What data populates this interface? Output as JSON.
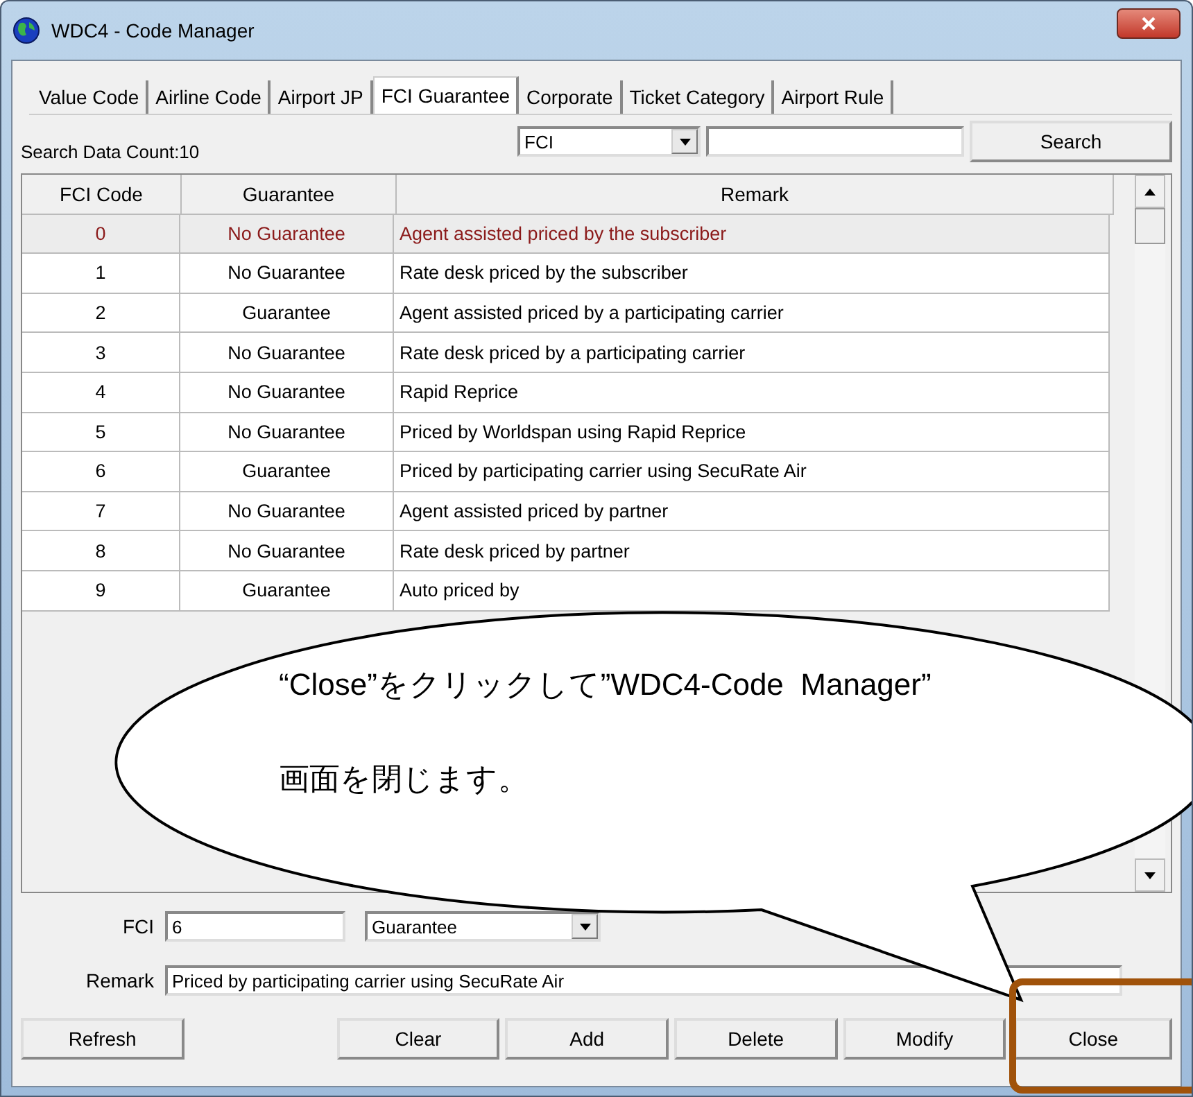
{
  "window": {
    "title": "WDC4 - Code Manager"
  },
  "tabs": [
    {
      "label": "Value Code",
      "selected": false
    },
    {
      "label": "Airline Code",
      "selected": false
    },
    {
      "label": "Airport JP",
      "selected": false
    },
    {
      "label": "FCI Guarantee",
      "selected": true
    },
    {
      "label": "Corporate",
      "selected": false
    },
    {
      "label": "Ticket Category",
      "selected": false
    },
    {
      "label": "Airport Rule",
      "selected": false
    }
  ],
  "search": {
    "count_label": "Search Data Count:10",
    "field_select": "FCI",
    "button": "Search"
  },
  "table": {
    "columns": [
      "FCI Code",
      "Guarantee",
      "Remark"
    ],
    "rows": [
      {
        "cells": [
          "0",
          "No Guarantee",
          "Agent assisted priced by the subscriber"
        ],
        "selected": true
      },
      {
        "cells": [
          "1",
          "No Guarantee",
          "Rate desk priced by the subscriber"
        ],
        "selected": false
      },
      {
        "cells": [
          "2",
          "Guarantee",
          "Agent assisted priced by a participating carrier"
        ],
        "selected": false
      },
      {
        "cells": [
          "3",
          "No Guarantee",
          "Rate desk priced by a participating carrier"
        ],
        "selected": false
      },
      {
        "cells": [
          "4",
          "No Guarantee",
          "Rapid Reprice"
        ],
        "selected": false
      },
      {
        "cells": [
          "5",
          "No Guarantee",
          "Priced by Worldspan using Rapid Reprice"
        ],
        "selected": false
      },
      {
        "cells": [
          "6",
          "Guarantee",
          "Priced by participating carrier using SecuRate Air"
        ],
        "selected": false
      },
      {
        "cells": [
          "7",
          "No Guarantee",
          "Agent assisted priced by partner"
        ],
        "selected": false
      },
      {
        "cells": [
          "8",
          "No Guarantee",
          "Rate desk priced by partner"
        ],
        "selected": false
      },
      {
        "cells": [
          "9",
          "Guarantee",
          "Auto priced by"
        ],
        "selected": false
      }
    ]
  },
  "form": {
    "fci_label": "FCI",
    "fci_value": "6",
    "guarantee_value": "Guarantee",
    "remark_label": "Remark",
    "remark_value": "Priced by participating carrier using SecuRate Air"
  },
  "buttons": [
    {
      "label": "Refresh",
      "highlighted": false
    },
    {
      "label": "Clear",
      "highlighted": false
    },
    {
      "label": "Add",
      "highlighted": false
    },
    {
      "label": "Delete",
      "highlighted": false
    },
    {
      "label": "Modify",
      "highlighted": false
    },
    {
      "label": "Close",
      "highlighted": true
    }
  ],
  "callout": {
    "lines": [
      "“Close”をクリックして”WDC4-Code  Manager”",
      "画面を閉じます。"
    ]
  }
}
